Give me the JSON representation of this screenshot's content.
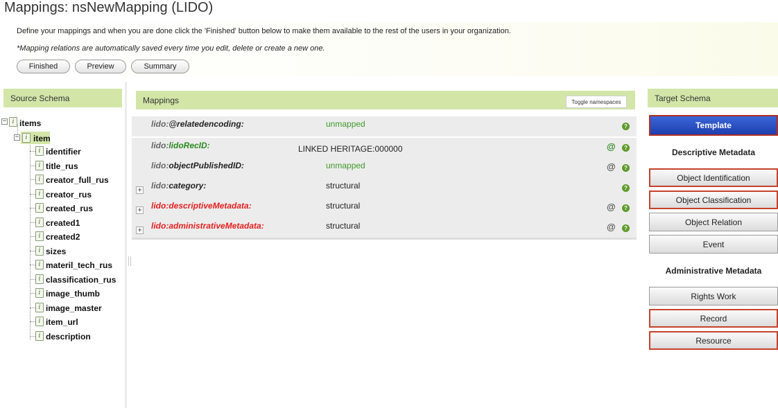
{
  "header": {
    "title": "Mappings: nsNewMapping (LIDO)",
    "intro": "Define your mappings and when you are done click the 'Finished' button below to make them available to the rest of the users in your organization.",
    "autosave_note": "*Mapping relations are automatically saved every time you edit, delete or create a new one."
  },
  "toolbar": {
    "finished": "Finished",
    "preview": "Preview",
    "summary": "Summary"
  },
  "source_schema": {
    "heading": "Source Schema",
    "root": "items",
    "item": "item",
    "fields": [
      "identifier",
      "title_rus",
      "creator_full_rus",
      "creator_rus",
      "created_rus",
      "created1",
      "created2",
      "sizes",
      "materil_tech_rus",
      "classification_rus",
      "image_thumb",
      "image_master",
      "item_url",
      "description"
    ]
  },
  "mappings": {
    "heading": "Mappings",
    "toggle_namespaces": "Toggle namespaces",
    "rows": [
      {
        "ns": "lido:",
        "name": "@relatedencoding:",
        "value": "unmapped"
      },
      {
        "ns": "lido:",
        "name": "lidoRecID:",
        "value": "LINKED HERITAGE:000000"
      },
      {
        "ns": "lido:",
        "name": "objectPublishedID:",
        "value": "unmapped"
      },
      {
        "ns": "lido:",
        "name": "category:",
        "value": "structural"
      },
      {
        "ns": "lido:",
        "name": "descriptiveMetadata:",
        "value": "structural"
      },
      {
        "ns": "lido:",
        "name": "administrativeMetadata:",
        "value": "structural"
      }
    ],
    "at_symbol": "@",
    "help_symbol": "?"
  },
  "target_schema": {
    "heading": "Target Schema",
    "template": "Template",
    "descriptive_heading": "Descriptive Metadata",
    "descriptive": [
      "Object Identification",
      "Object Classification",
      "Object Relation",
      "Event"
    ],
    "administrative_heading": "Administrative Metadata",
    "administrative": [
      "Rights Work",
      "Record",
      "Resource"
    ]
  },
  "colors": {
    "panel_header": "#d3e6a8",
    "template_button": "#2a4fc4",
    "error_red": "#e32020",
    "mapped_green": "#2b8a1e"
  }
}
